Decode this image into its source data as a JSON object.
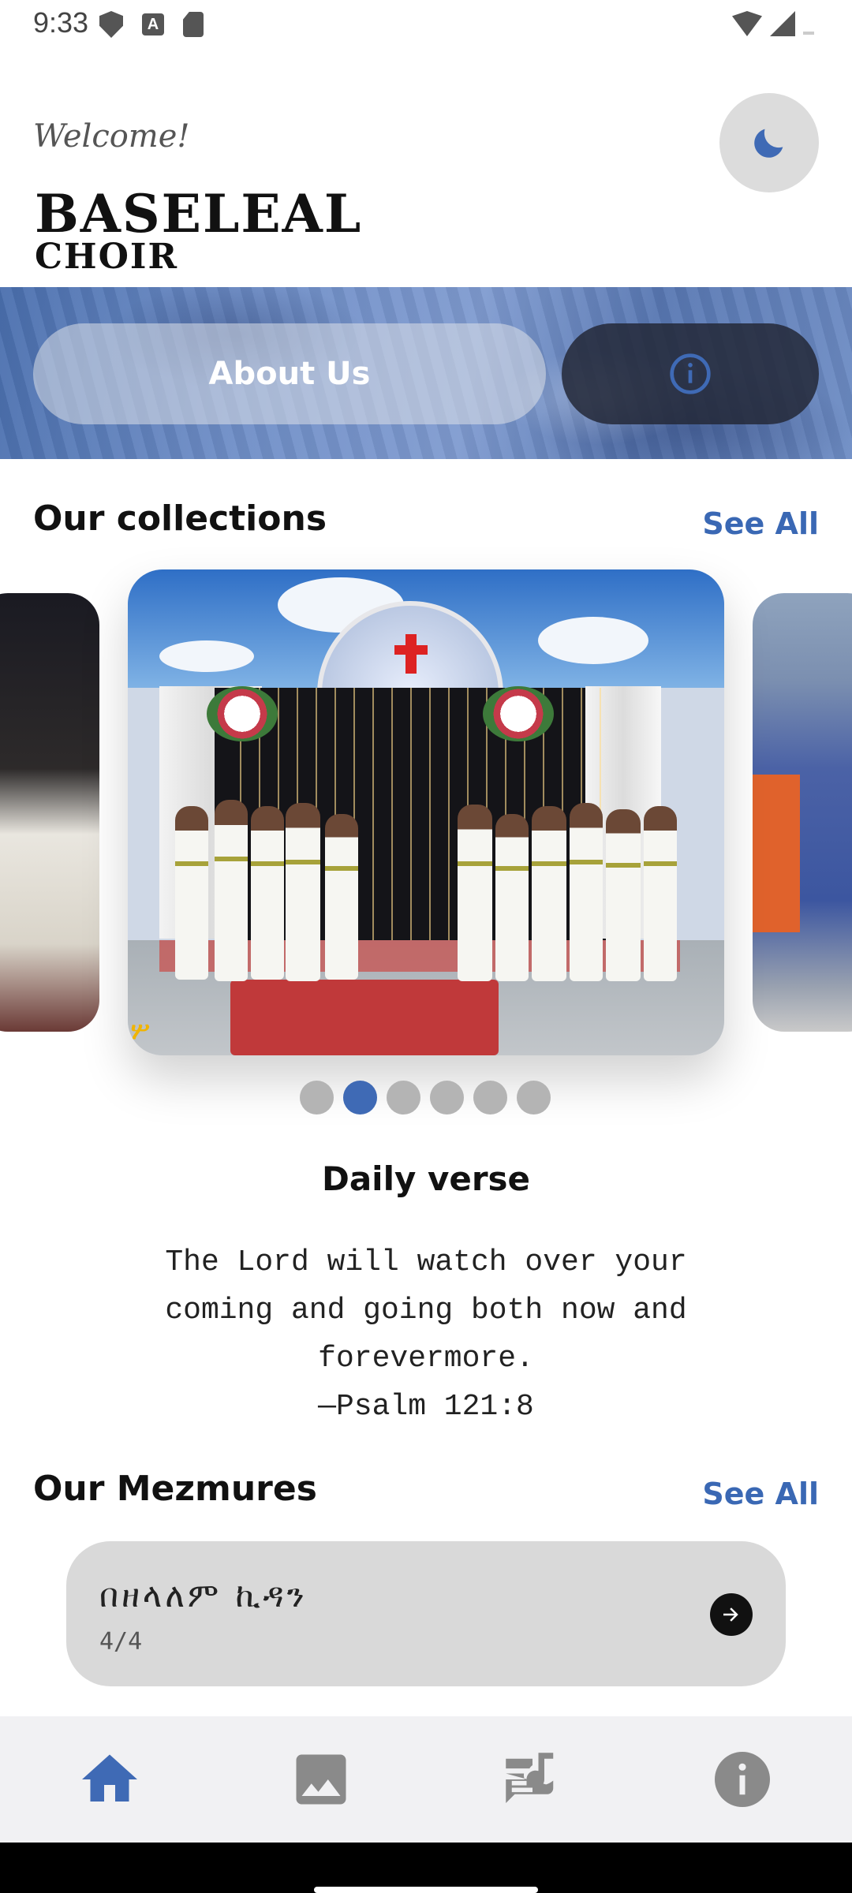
{
  "status_bar": {
    "time": "9:33",
    "icons_left": [
      "shield-icon",
      "font-icon",
      "sd-card-icon"
    ],
    "icons_right": [
      "wifi-icon",
      "cell-signal-icon",
      "battery-icon"
    ],
    "font_icon_letter": "A"
  },
  "header": {
    "welcome": "Welcome!",
    "brand_line1": "BASELEAL",
    "brand_line2": "CHOIR",
    "theme_toggle_icon": "moon-icon"
  },
  "banner": {
    "about_label": "About Us",
    "info_icon": "info-icon"
  },
  "collections": {
    "title": "Our collections",
    "see_all": "See All",
    "watermark": "ሦ",
    "dot_count": 6,
    "active_index": 1
  },
  "daily_verse": {
    "title": "Daily verse",
    "text": "The Lord will watch over your coming and going both now and forevermore.",
    "reference": "—Psalm 121:8"
  },
  "mezmures": {
    "title": "Our Mezmures",
    "see_all": "See All",
    "items": [
      {
        "title": "በዘላለም ኪዳን",
        "count": "4/4",
        "action_icon": "arrow-right-icon"
      }
    ]
  },
  "bottom_nav": {
    "items": [
      {
        "icon": "home-icon",
        "active": true
      },
      {
        "icon": "image-icon",
        "active": false
      },
      {
        "icon": "lyrics-icon",
        "active": false
      },
      {
        "icon": "info-icon",
        "active": false
      }
    ]
  },
  "colors": {
    "accent": "#3f6ab5",
    "see_all": "#3a68b4",
    "inactive_icon": "#8a8a8a",
    "card_bg": "#d9d9d9",
    "nav_bg": "#f1f1f3"
  }
}
